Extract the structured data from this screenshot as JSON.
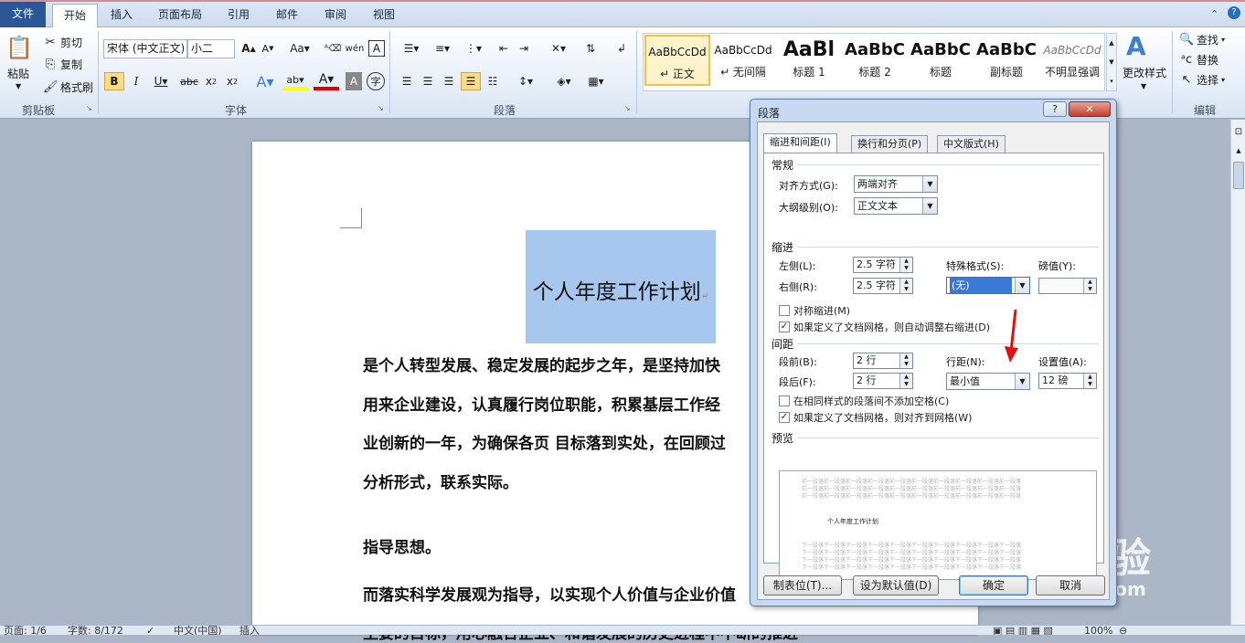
{
  "tabs": [
    "文件",
    "开始",
    "插入",
    "页面布局",
    "引用",
    "邮件",
    "审阅",
    "视图"
  ],
  "ribbon": {
    "clipboard": {
      "paste": "粘贴",
      "cut": "剪切",
      "copy": "复制",
      "painter": "格式刷",
      "label": "剪贴板"
    },
    "font": {
      "name": "宋体 (中文正文)",
      "size": "小二",
      "label": "字体"
    },
    "paragraph": {
      "label": "段落"
    },
    "styles": [
      {
        "sample": "AaBbCcDd",
        "name": "↵ 正文"
      },
      {
        "sample": "AaBbCcDd",
        "name": "↵ 无间隔"
      },
      {
        "sample": "AaBl",
        "name": "标题 1"
      },
      {
        "sample": "AaBbC",
        "name": "标题 2"
      },
      {
        "sample": "AaBbC",
        "name": "标题"
      },
      {
        "sample": "AaBbC",
        "name": "副标题"
      },
      {
        "sample": "AaBbCcDd",
        "name": "不明显强调"
      }
    ],
    "change_styles": "更改样式",
    "editing": {
      "find": "查找",
      "replace": "替换",
      "select": "选择",
      "label": "编辑"
    }
  },
  "document": {
    "title": "个人年度工作计划",
    "lines": [
      "是个人转型发展、稳定发展的起步之年，是坚持加快",
      "用来企业建设，认真履行岗位职能，积累基层工作经",
      "业创新的一年，为确保各页  目标落到实处，在回顾过",
      "分析形式，联系实际。",
      "指导思想。",
      "而落实科学发展观为指导，以实现个人价值与企业价值",
      "主要的目标，用心融合企业、和谐发展的历史进程中不断的推进"
    ]
  },
  "status": {
    "page": "页面: 1/6",
    "words": "字数: 8/172",
    "lang": "中文(中国)",
    "mode": "插入",
    "zoom": "100%"
  },
  "dialog": {
    "title": "段落",
    "help": "?",
    "tabs": [
      "缩进和间距(I)",
      "换行和分页(P)",
      "中文版式(H)"
    ],
    "general": "常规",
    "align_label": "对齐方式(G):",
    "align_value": "两端对齐",
    "outline_label": "大纲级别(O):",
    "outline_value": "正文文本",
    "indent": "缩进",
    "left_label": "左侧(L):",
    "left_value": "2.5 字符",
    "right_label": "右侧(R):",
    "right_value": "2.5 字符",
    "special_label": "特殊格式(S):",
    "special_value": "(无)",
    "by_label": "磅值(Y):",
    "by_value": "",
    "mirror": "对称缩进(M)",
    "auto_right": "如果定义了文档网格，则自动调整右缩进(D)",
    "spacing": "间距",
    "before_label": "段前(B):",
    "before_value": "2 行",
    "after_label": "段后(F):",
    "after_value": "2 行",
    "line_label": "行距(N):",
    "line_value": "最小值",
    "at_label": "设置值(A):",
    "at_value": "12 磅",
    "no_space": "在相同样式的段落间不添加空格(C)",
    "snap_grid": "如果定义了文档网格，则对齐到网格(W)",
    "preview": "预览",
    "preview_text": "个人年度工作计划",
    "preview_prev": "前一段落前一段落前一段落前一段落前一段落前一段落前一段落前一段落前一段落前一段落",
    "preview_next": "下一段落下一段落下一段落下一段落下一段落下一段落下一段落下一段落下一段落下一段落",
    "tabs_btn": "制表位(T)...",
    "default_btn": "设为默认值(D)",
    "ok": "确定",
    "cancel": "取消"
  },
  "watermark": {
    "main": "Baidu经验",
    "sub": "jingyan.baidu.com"
  }
}
